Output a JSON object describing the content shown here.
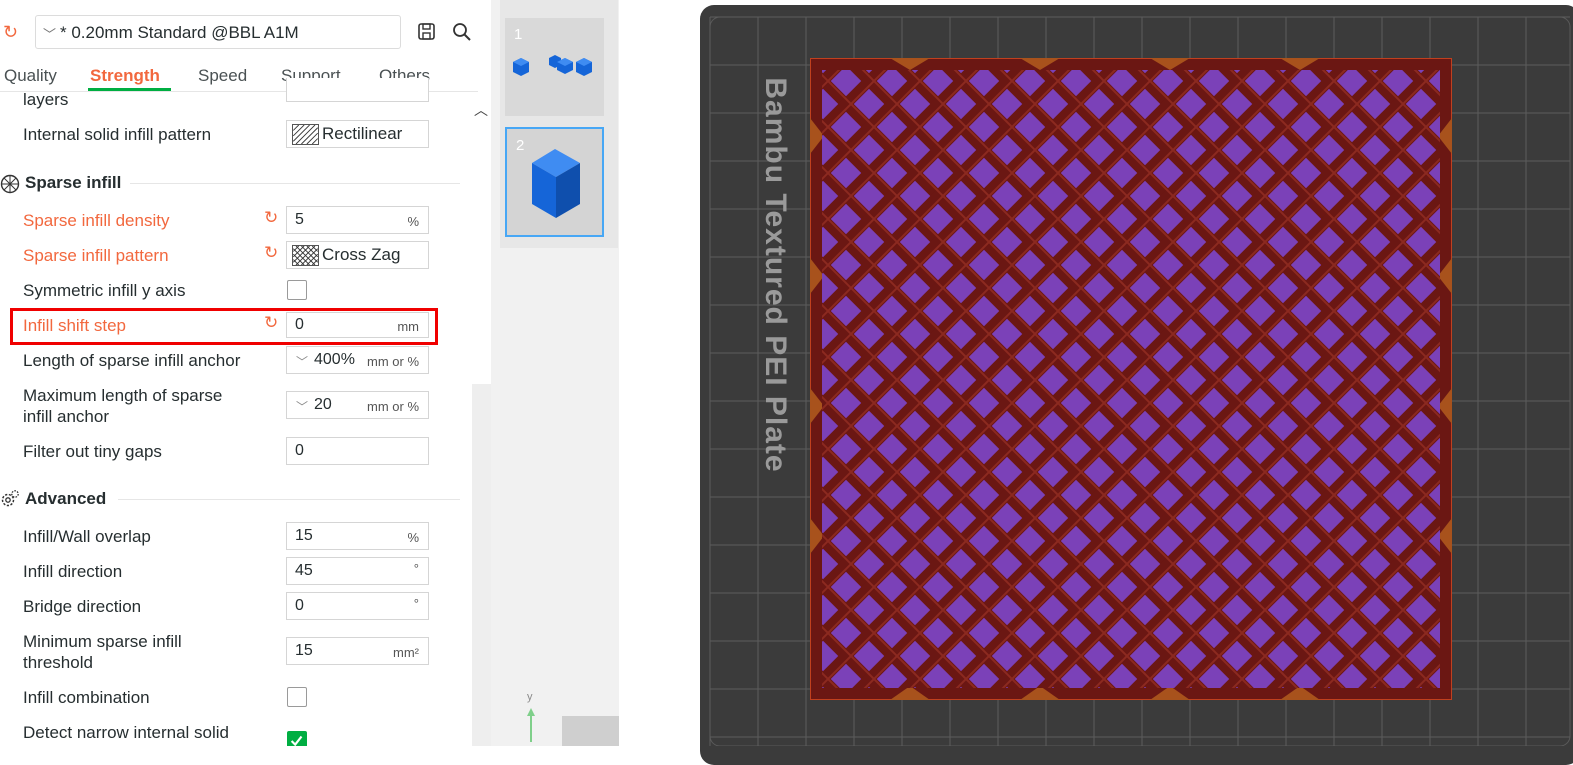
{
  "preset": {
    "name": "* 0.20mm Standard @BBL A1M"
  },
  "tabs": [
    {
      "label": "Quality",
      "active": false
    },
    {
      "label": "Strength",
      "active": true
    },
    {
      "label": "Speed",
      "active": false
    },
    {
      "label": "Support",
      "active": false
    },
    {
      "label": "Others",
      "active": false
    }
  ],
  "settings": {
    "partial_label": "layers",
    "internal_solid_infill_pattern": {
      "label": "Internal solid infill pattern",
      "value": "Rectilinear"
    },
    "sparse_infill": {
      "title": "Sparse infill",
      "density": {
        "label": "Sparse infill density",
        "value": "5",
        "unit": "%"
      },
      "pattern": {
        "label": "Sparse infill pattern",
        "value": "Cross Zag"
      },
      "symmetric_y": {
        "label": "Symmetric infill y axis",
        "checked": false
      },
      "shift_step": {
        "label": "Infill shift step",
        "value": "0",
        "unit": "mm"
      },
      "anchor_length": {
        "label": "Length of sparse infill anchor",
        "value": "400%",
        "unit": "mm or %"
      },
      "max_anchor_length": {
        "label_line1": "Maximum length of sparse",
        "label_line2": "infill anchor",
        "value": "20",
        "unit": "mm or %"
      },
      "filter_gaps": {
        "label": "Filter out tiny gaps",
        "value": "0"
      }
    },
    "advanced": {
      "title": "Advanced",
      "wall_overlap": {
        "label": "Infill/Wall overlap",
        "value": "15",
        "unit": "%"
      },
      "infill_direction": {
        "label": "Infill direction",
        "value": "45",
        "unit": "°"
      },
      "bridge_direction": {
        "label": "Bridge direction",
        "value": "0",
        "unit": "°"
      },
      "min_sparse_threshold": {
        "label_line1": "Minimum sparse infill",
        "label_line2": "threshold",
        "value": "15",
        "unit": "mm²"
      },
      "infill_combination": {
        "label": "Infill combination",
        "checked": false
      },
      "detect_narrow": {
        "label": "Detect narrow internal solid",
        "checked": true
      }
    }
  },
  "plates": [
    {
      "number": "1"
    },
    {
      "number": "2",
      "selected": true
    }
  ],
  "viewport": {
    "plate_label": "Bambu Textured PEI Plate",
    "axis_label": "y"
  },
  "colors": {
    "accent": "#f2683e",
    "active_tab_underline": "#00ae42",
    "highlight": "#f00000",
    "infill_purple": "#7b41b8",
    "infill_maroon": "#6b1713"
  }
}
